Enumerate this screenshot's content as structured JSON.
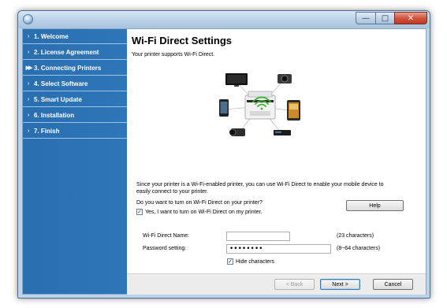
{
  "window": {
    "controls": {
      "minimize": "—",
      "maximize": "□",
      "close": "✕"
    }
  },
  "sidebar": {
    "steps": [
      {
        "marker": "›",
        "label": "1. Welcome"
      },
      {
        "marker": "›",
        "label": "2. License Agreement"
      },
      {
        "marker": "▶▶",
        "label": "3. Connecting Printers"
      },
      {
        "marker": "›",
        "label": "4. Select Software"
      },
      {
        "marker": "›",
        "label": "5. Smart Update"
      },
      {
        "marker": "›",
        "label": "6. Installation"
      },
      {
        "marker": "›",
        "label": "7. Finish"
      }
    ],
    "current_step": 2
  },
  "main": {
    "title": "Wi-Fi Direct Settings",
    "subtitle": "Your printer supports Wi-Fi Direct.",
    "info_line1": "Since your printer is a Wi-Fi-enabled printer, you can use Wi-Fi Direct to enable your mobile device to",
    "info_line2": "easily connect to your printer.",
    "question": "Do you want to turn on Wi-Fi Direct on your printer?",
    "enable_checkbox": {
      "checked": true,
      "mark": "✓",
      "label": "Yes, I want to turn on Wi-Fi Direct on my printer."
    },
    "help_label": "Help",
    "wifi_name": {
      "label": "Wi-Fi Direct Name:",
      "value": "",
      "hint": "(23 characters)"
    },
    "password": {
      "label": "Password setting:",
      "value": "••••••••",
      "hint": "(8~64 characters)"
    },
    "hide_checkbox": {
      "checked": true,
      "mark": "✓",
      "label": "Hide characters"
    }
  },
  "footer": {
    "back_label": "< Back",
    "next_label": "Next >",
    "cancel_label": "Cancel"
  },
  "colors": {
    "sidebar": "#2d76b8",
    "sidebar_divider": "#9ec3e4",
    "wifi_green": "#3fae3a",
    "title_bar": "#b8d0e8"
  }
}
